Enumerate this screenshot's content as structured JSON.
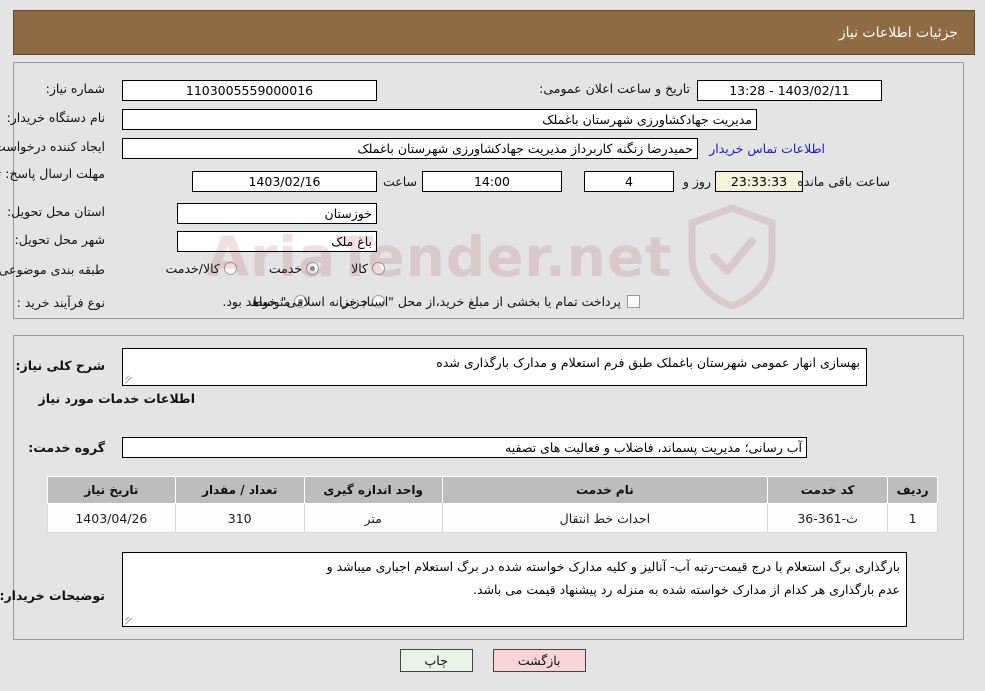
{
  "header": {
    "title": "جزئیات اطلاعات نیاز"
  },
  "colors": {
    "header_bar": "#8d6b43",
    "page_bg": "#e4e4e4",
    "link": "#1a1ad6",
    "table_header": "#bdbdbd",
    "btn_print": "#e8f5e4",
    "btn_back": "#f8d4d4",
    "countdown_bg": "#f5f2dc"
  },
  "top_form": {
    "need_number": {
      "label": "شماره نیاز:",
      "value": "1103005559000016"
    },
    "buyer_org": {
      "label": "نام دستگاه خریدار:",
      "value": "مدیریت جهادکشاورزی شهرستان باغملک"
    },
    "requester": {
      "label": "ایجاد کننده درخواست:",
      "value": "حمیدرضا زنگنه کاربرداز مدیریت جهادکشاورزی شهرستان باغملک"
    },
    "contact_link": "اطلاعات تماس خریدار",
    "announce_datetime": {
      "label": "تاریخ و ساعت اعلان عمومی:",
      "value": "1403/02/11 - 13:28"
    },
    "deadline": {
      "label": "مهلت ارسال پاسخ: تا تاریخ:",
      "date": "1403/02/16",
      "time_label": "ساعت",
      "time": "14:00",
      "days": "4",
      "days_label": "روز و",
      "countdown": "23:33:33",
      "countdown_label": "ساعت باقی مانده"
    },
    "province": {
      "label": "استان محل تحویل:",
      "value": "خوزستان"
    },
    "city": {
      "label": "شهر محل تحویل:",
      "value": "باغ ملک"
    },
    "category": {
      "label": "طبقه بندی موضوعی:",
      "options": [
        "کالا",
        "خدمت",
        "کالا/خدمت"
      ],
      "selected": "خدمت"
    },
    "purchase_type": {
      "label": "نوع فرآیند خرید :",
      "options": [
        "جزیی",
        "متوسط"
      ],
      "selected": "متوسط"
    },
    "treasury_note": {
      "checked": false,
      "text": "پرداخت تمام یا بخشی از مبلغ خرید،از محل \"اسناد خزانه اسلامی\" خواهد بود."
    }
  },
  "bottom": {
    "general_desc": {
      "label": "شرح کلی نیاز:",
      "value": "بهسازی انهار عمومی شهرستان باغملک طبق فرم استعلام و مدارک بارگذاری شده"
    },
    "services_section_title": "اطلاعات خدمات مورد نیاز",
    "service_group": {
      "label": "گروه خدمت:",
      "value": "آب رسانی؛ مدیریت پسماند، فاضلاب و فعالیت های تصفیه"
    },
    "table": {
      "columns": [
        "ردیف",
        "کد خدمت",
        "نام خدمت",
        "واحد اندازه گیری",
        "تعداد / مقدار",
        "تاریخ نیاز"
      ],
      "rows": [
        {
          "radif": "1",
          "code": "ث-361-36",
          "name": "احداث خط انتقال",
          "unit": "متر",
          "qty": "310",
          "date": "1403/04/26"
        }
      ]
    },
    "buyer_notes": {
      "label": "توضیحات خریدار:",
      "line1": "بارگذاری برگ استعلام با درج قیمت-رتبه آب- آنالیز و کلیه مدارک خواسته شده در برگ استعلام اجباری میباشد و",
      "line2": "عدم بارگذاری هر کدام از مدارک خواسته شده به منزله رد پیشنهاد قیمت می باشد."
    }
  },
  "buttons": {
    "print": "چاپ",
    "back": "بازگشت"
  },
  "watermark": {
    "text": "AriaTender.net"
  }
}
